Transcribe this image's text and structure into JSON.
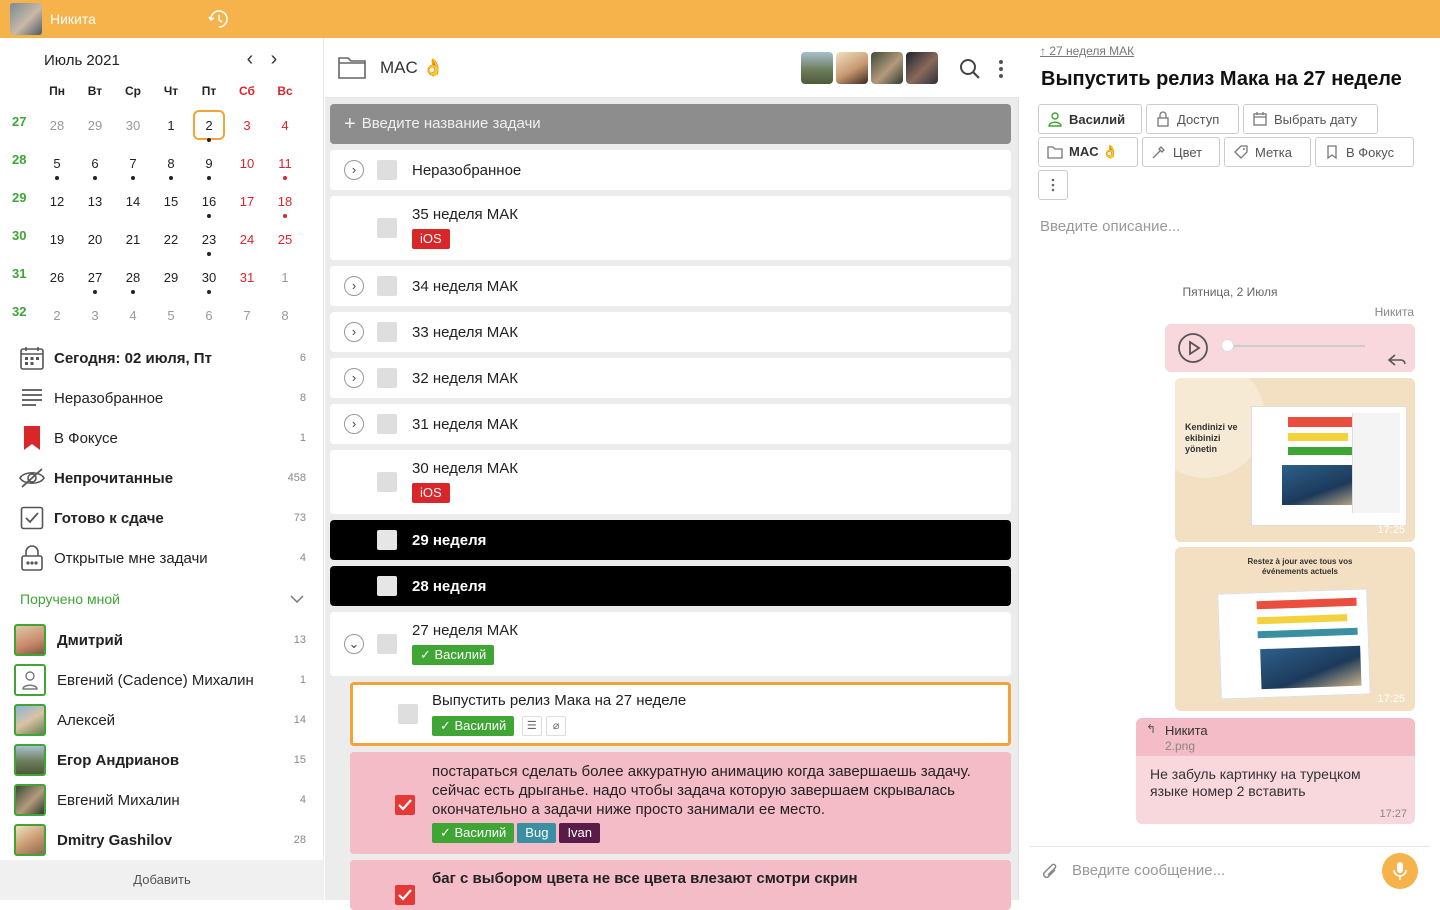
{
  "topbar": {
    "user_name": "Никита"
  },
  "calendar": {
    "month_label": "Июль 2021",
    "weekdays": [
      "Пн",
      "Вт",
      "Ср",
      "Чт",
      "Пт",
      "Сб",
      "Вс"
    ],
    "weeks": [
      {
        "num": "27",
        "days": [
          "28",
          "29",
          "30",
          "1",
          "2",
          "3",
          "4"
        ]
      },
      {
        "num": "28",
        "days": [
          "5",
          "6",
          "7",
          "8",
          "9",
          "10",
          "11"
        ]
      },
      {
        "num": "29",
        "days": [
          "12",
          "13",
          "14",
          "15",
          "16",
          "17",
          "18"
        ]
      },
      {
        "num": "30",
        "days": [
          "19",
          "20",
          "21",
          "22",
          "23",
          "24",
          "25"
        ]
      },
      {
        "num": "31",
        "days": [
          "26",
          "27",
          "28",
          "29",
          "30",
          "31",
          "1"
        ]
      },
      {
        "num": "32",
        "days": [
          "2",
          "3",
          "4",
          "5",
          "6",
          "7",
          "8"
        ]
      }
    ]
  },
  "nav": [
    {
      "label": "Сегодня: 02 июля, Пт",
      "count": "6"
    },
    {
      "label": "Неразобранное",
      "count": "8"
    },
    {
      "label": "В Фокусе",
      "count": "1"
    },
    {
      "label": "Непрочитанные",
      "count": "458"
    },
    {
      "label": "Готово к сдаче",
      "count": "73"
    },
    {
      "label": "Открытые мне задачи",
      "count": "4"
    }
  ],
  "assigned_label": "Поручено мной",
  "people": [
    {
      "name": "Дмитрий",
      "count": "13"
    },
    {
      "name": "Евгений (Cadence) Михалин",
      "count": "1"
    },
    {
      "name": "Алексей",
      "count": "14"
    },
    {
      "name": "Егор Андрианов",
      "count": "15"
    },
    {
      "name": "Евгений Михалин",
      "count": "4"
    },
    {
      "name": "Dmitry Gashilov",
      "count": "28"
    }
  ],
  "add_label": "Добавить",
  "project": {
    "name": "MAC 👌"
  },
  "new_task_placeholder": "Введите название задачи",
  "tasks": [
    {
      "title": "Неразобранное"
    },
    {
      "title": "35 неделя МАК",
      "tag": "iOS"
    },
    {
      "title": "34 неделя МАК"
    },
    {
      "title": "33 неделя МАК"
    },
    {
      "title": "32 неделя МАК"
    },
    {
      "title": "31 неделя МАК"
    },
    {
      "title": "30 неделя МАК",
      "tag": "iOS"
    },
    {
      "title": "29 неделя"
    },
    {
      "title": "28 неделя"
    },
    {
      "title": "27 неделя МАК",
      "tag": "Василий"
    }
  ],
  "subtasks": [
    {
      "title": "Выпустить релиз Мака на 27 неделе",
      "tag": "Василий"
    },
    {
      "title": "постараться сделать более  аккуратную анимацию когда завершаешь задачу. сейчас есть дрыганье. надо чтобы задача которую завершаем скрывалась окончательно а задачи ниже просто занимали ее место.",
      "tags": [
        "Василий",
        "Bug",
        "Ivan"
      ]
    },
    {
      "title": "баг с выбором цвета не все цвета влезают смотри скрин"
    }
  ],
  "detail": {
    "parent_link": "27 неделя МАК",
    "title": "Выпустить релиз Мака на 27 неделе",
    "chips": [
      "Василий",
      "Доступ",
      "Выбрать дату",
      "MAC 👌",
      "Цвет",
      "Метка",
      "В Фокус"
    ],
    "description_placeholder": "Введите описание...",
    "date_separator": "Пятница, 2 Июля",
    "sender": "Никита",
    "image1_text": "Kendinizi ve ekibinizi yönetin",
    "image1_time": "17:25",
    "image2_text": "Restez à jour avec tous vos événements actuels",
    "image2_time": "17:25",
    "reply_author": "Никита",
    "reply_file": "2.png",
    "reply_text": "Не забуль картинку на турецком языке номер 2 вставить",
    "reply_time": "17:27",
    "message_placeholder": "Введите сообщение..."
  },
  "colors": {
    "accent": "#f6b24b",
    "green": "#3fa535",
    "red": "#d9262b"
  }
}
